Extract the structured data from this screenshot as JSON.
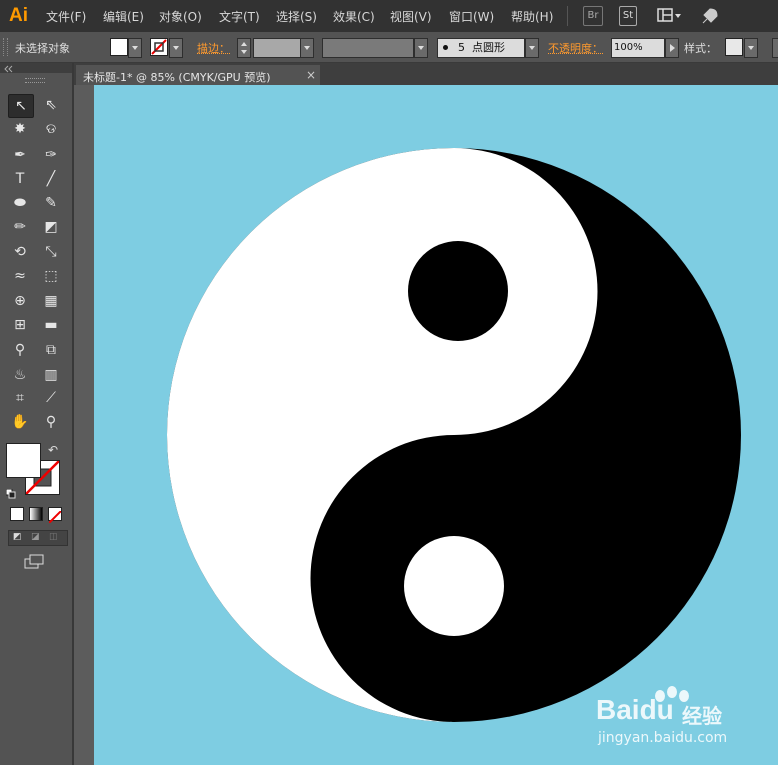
{
  "app": {
    "logo": "Ai",
    "accent": "#ff9a00"
  },
  "menu": [
    "文件(F)",
    "编辑(E)",
    "对象(O)",
    "文字(T)",
    "选择(S)",
    "效果(C)",
    "视图(V)",
    "窗口(W)",
    "帮助(H)"
  ],
  "menubar_buttons": {
    "bridge": "Br",
    "stock": "St"
  },
  "control": {
    "selection": "未选择对象",
    "stroke_label": "描边：",
    "brush_size": "5",
    "brush_name": "点圆形",
    "opacity_label": "不透明度：",
    "opacity_value": "100%",
    "style_label": "样式："
  },
  "tab": {
    "title": "未标题-1* @ 85% (CMYK/GPU 预览)",
    "close": "×"
  },
  "tools": [
    {
      "icon": "selection-tool-icon",
      "glyph": "↖"
    },
    {
      "icon": "direct-selection-tool-icon",
      "glyph": "⇖"
    },
    {
      "icon": "magic-wand-tool-icon",
      "glyph": "✸"
    },
    {
      "icon": "lasso-tool-icon",
      "glyph": "ଡ"
    },
    {
      "icon": "pen-tool-icon",
      "glyph": "✒"
    },
    {
      "icon": "curvature-tool-icon",
      "glyph": "✑"
    },
    {
      "icon": "type-tool-icon",
      "glyph": "T"
    },
    {
      "icon": "line-segment-tool-icon",
      "glyph": "╱"
    },
    {
      "icon": "ellipse-tool-icon",
      "glyph": "⬬"
    },
    {
      "icon": "paintbrush-tool-icon",
      "glyph": "✎"
    },
    {
      "icon": "pencil-tool-icon",
      "glyph": "✏"
    },
    {
      "icon": "eraser-tool-icon",
      "glyph": "◩"
    },
    {
      "icon": "rotate-tool-icon",
      "glyph": "⟲"
    },
    {
      "icon": "scale-tool-icon",
      "glyph": "⤡"
    },
    {
      "icon": "width-tool-icon",
      "glyph": "≈"
    },
    {
      "icon": "free-transform-tool-icon",
      "glyph": "⬚"
    },
    {
      "icon": "shape-builder-tool-icon",
      "glyph": "⊕"
    },
    {
      "icon": "perspective-grid-tool-icon",
      "glyph": "▦"
    },
    {
      "icon": "mesh-tool-icon",
      "glyph": "⊞"
    },
    {
      "icon": "gradient-tool-icon",
      "glyph": "▬"
    },
    {
      "icon": "eyedropper-tool-icon",
      "glyph": "⚲"
    },
    {
      "icon": "blend-tool-icon",
      "glyph": "⧉"
    },
    {
      "icon": "symbol-sprayer-tool-icon",
      "glyph": "♨"
    },
    {
      "icon": "column-graph-tool-icon",
      "glyph": "▥"
    },
    {
      "icon": "artboard-tool-icon",
      "glyph": "⌗"
    },
    {
      "icon": "slice-tool-icon",
      "glyph": "⟋"
    },
    {
      "icon": "hand-tool-icon",
      "glyph": "✋"
    },
    {
      "icon": "zoom-tool-icon",
      "glyph": "⚲"
    }
  ],
  "colors": {
    "canvas_bg": "#7ecde2",
    "yin": "#000000",
    "yang": "#ffffff"
  },
  "watermark": {
    "brand": "Baidu",
    "cn": "经验",
    "url": "jingyan.baidu.com"
  }
}
